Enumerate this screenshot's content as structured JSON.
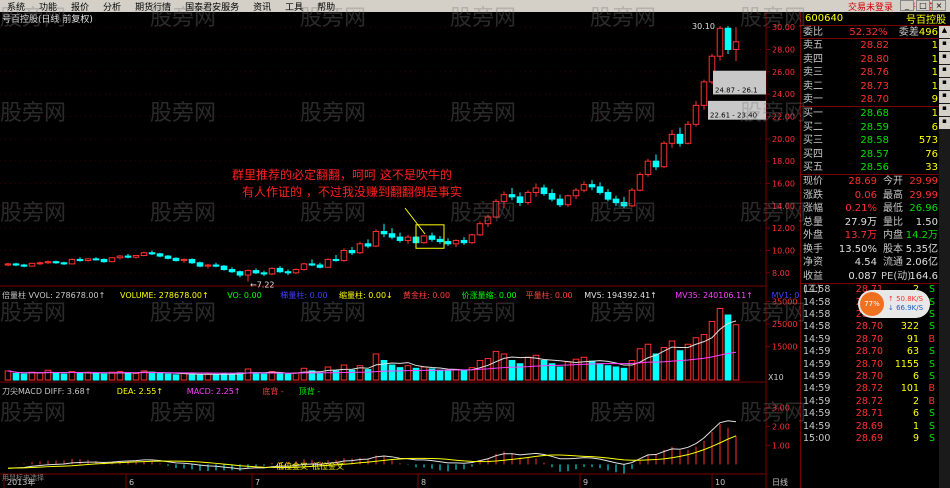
{
  "menu": {
    "items": [
      "系统",
      "功能",
      "报价",
      "分析",
      "期货行情",
      "国泰君安服务",
      "资讯",
      "工具",
      "帮助"
    ],
    "hot_items": [
      "交易未登录",
      "号百控股"
    ]
  },
  "stock": {
    "code": "600640",
    "name": "号百控股",
    "title": "号百控股(日线 前复权)"
  },
  "orderbook": {
    "weibi_label": "委比",
    "weibi": "52.32%",
    "weicha_label": "委差",
    "weicha": "496",
    "asks": [
      {
        "label": "卖五",
        "price": "28.82",
        "vol": "1"
      },
      {
        "label": "卖四",
        "price": "28.80",
        "vol": "1"
      },
      {
        "label": "卖三",
        "price": "28.76",
        "vol": "1"
      },
      {
        "label": "卖二",
        "price": "28.73",
        "vol": "1"
      },
      {
        "label": "卖一",
        "price": "28.70",
        "vol": "9"
      }
    ],
    "bids": [
      {
        "label": "买一",
        "price": "28.68",
        "vol": "1"
      },
      {
        "label": "买二",
        "price": "28.59",
        "vol": "6"
      },
      {
        "label": "买三",
        "price": "28.58",
        "vol": "573"
      },
      {
        "label": "买四",
        "price": "28.57",
        "vol": "76"
      },
      {
        "label": "买五",
        "price": "28.56",
        "vol": "33"
      }
    ]
  },
  "stats": [
    {
      "a": "现价",
      "b": "28.69",
      "c": "今开",
      "d": "29.99"
    },
    {
      "a": "涨跌",
      "b": "0.06",
      "c": "最高",
      "d": "29.99"
    },
    {
      "a": "涨幅",
      "b": "0.21%",
      "c": "最低",
      "d": "26.96"
    },
    {
      "a": "总量",
      "b": "27.9万",
      "c": "量比",
      "d": "1.50"
    },
    {
      "a": "外盘",
      "b": "13.7万",
      "c": "内盘",
      "d": "14.2万"
    },
    {
      "a": "换手",
      "b": "13.50%",
      "c": "股本",
      "d": "5.35亿"
    },
    {
      "a": "净资",
      "b": "4.54",
      "c": "流通",
      "d": "2.06亿"
    },
    {
      "a": "收益(二)",
      "b": "0.087",
      "c": "PE(动)",
      "d": "164.6"
    }
  ],
  "ticks": [
    {
      "t": "14:58",
      "p": "28.71",
      "v": "2",
      "s": "S"
    },
    {
      "t": "14:58",
      "p": "28.73",
      "v": "55",
      "s": "S"
    },
    {
      "t": "14:58",
      "p": "28.72",
      "v": "297",
      "s": "S"
    },
    {
      "t": "14:58",
      "p": "28.70",
      "v": "322",
      "s": "S"
    },
    {
      "t": "14:59",
      "p": "28.70",
      "v": "91",
      "s": "B"
    },
    {
      "t": "14:59",
      "p": "28.70",
      "v": "63",
      "s": "S"
    },
    {
      "t": "14:59",
      "p": "28.70",
      "v": "1155",
      "s": "S"
    },
    {
      "t": "14:59",
      "p": "28.70",
      "v": "6",
      "s": "S"
    },
    {
      "t": "14:59",
      "p": "28.72",
      "v": "101",
      "s": "B"
    },
    {
      "t": "14:59",
      "p": "28.72",
      "v": "2",
      "s": "B"
    },
    {
      "t": "14:59",
      "p": "28.71",
      "v": "6",
      "s": "S"
    },
    {
      "t": "14:59",
      "p": "28.69",
      "v": "1",
      "s": "S"
    },
    {
      "t": "15:00",
      "p": "28.69",
      "v": "9",
      "s": "S"
    }
  ],
  "net_widget": {
    "pct": "77%",
    "up": "↑ 50.8K/S",
    "down": "↓ 66.9K/S"
  },
  "price_axis": [
    "30.00",
    "28.00",
    "26.00",
    "24.00",
    "22.00",
    "20.00",
    "18.00",
    "16.00",
    "14.00",
    "12.00",
    "10.00",
    "8.00"
  ],
  "price_labels": {
    "high": "30.10",
    "low": "7.22",
    "box1": "24.87 - 26.1",
    "box2": "22.61 - 23.40"
  },
  "annotation": {
    "line1": "群里推荐的必定翻翻，呵呵  这不是吹牛的",
    "line2": "有人作证的    ，不过我没赚到翻翻倒是事实"
  },
  "vol_header": [
    {
      "text": "倍量柱 VVOL: 278678.00↑",
      "color": "#c8c8c8"
    },
    {
      "text": "VOLUME: 278678.00↑",
      "color": "#ffff00"
    },
    {
      "text": "VO: 0.00",
      "color": "#00ff00"
    },
    {
      "text": "梯量柱: 0.00",
      "color": "#4040ff"
    },
    {
      "text": "缩量柱: 0.00↓",
      "color": "#ffff00"
    },
    {
      "text": "黄金柱: 0.00",
      "color": "#ff4040"
    },
    {
      "text": "价涨量缩: 0.00",
      "color": "#00ff00"
    },
    {
      "text": "平量柱: 0.00",
      "color": "#ff4040"
    },
    {
      "text": "MV5: 194392.41↑",
      "color": "#e0e0e0"
    },
    {
      "text": "MV35: 240106.11↑",
      "color": "#ff40ff"
    },
    {
      "text": "MV1: 0↑",
      "color": "#4040ff"
    }
  ],
  "vol_axis": [
    "35000",
    "25000",
    "15000"
  ],
  "vol_unit": "X10",
  "macd_header": [
    {
      "text": "刀尖MACD DIFF: 3.68↑",
      "color": "#c8c8c8"
    },
    {
      "text": "DEA: 2.55↑",
      "color": "#ffff00"
    },
    {
      "text": "MACD: 2.25↑",
      "color": "#ff40ff"
    },
    {
      "text": "底背 -",
      "color": "#ff4040"
    },
    {
      "text": "顶背 -",
      "color": "#00ff00"
    }
  ],
  "macd_axis": [
    "3.00",
    "2.00",
    "1.00"
  ],
  "macd_labels": {
    "a": "低位金叉",
    "b": "低位金叉"
  },
  "date_axis": [
    "2013年",
    "6",
    "7",
    "8",
    "9",
    "10"
  ],
  "period": "日线",
  "bottom_left": "用鼠标来选择",
  "watermark": "股旁网",
  "colors": {
    "up": "#ff3030",
    "down": "#00ffff",
    "axis": "#7a0000",
    "grid": "#3a0000"
  },
  "candles": [
    [
      8.7,
      8.9,
      8.6,
      8.8
    ],
    [
      8.8,
      8.9,
      8.6,
      8.7
    ],
    [
      8.7,
      8.8,
      8.5,
      8.6
    ],
    [
      8.6,
      8.9,
      8.6,
      8.85
    ],
    [
      8.85,
      9.0,
      8.7,
      8.9
    ],
    [
      8.9,
      9.1,
      8.8,
      9.0
    ],
    [
      9.0,
      9.1,
      8.8,
      8.9
    ],
    [
      8.9,
      9.0,
      8.7,
      8.8
    ],
    [
      8.8,
      9.3,
      8.8,
      9.2
    ],
    [
      9.2,
      9.4,
      9.0,
      9.1
    ],
    [
      9.1,
      9.3,
      9.0,
      9.25
    ],
    [
      9.25,
      9.4,
      9.1,
      9.2
    ],
    [
      9.2,
      9.3,
      8.9,
      9.0
    ],
    [
      9.0,
      9.4,
      9.0,
      9.35
    ],
    [
      9.35,
      9.6,
      9.2,
      9.5
    ],
    [
      9.5,
      9.7,
      9.3,
      9.4
    ],
    [
      9.4,
      9.6,
      9.3,
      9.55
    ],
    [
      9.55,
      9.9,
      9.5,
      9.8
    ],
    [
      9.8,
      10.0,
      9.6,
      9.7
    ],
    [
      9.7,
      9.8,
      9.4,
      9.5
    ],
    [
      9.5,
      9.6,
      9.2,
      9.3
    ],
    [
      9.3,
      9.4,
      9.0,
      9.1
    ],
    [
      9.1,
      9.3,
      8.9,
      9.2
    ],
    [
      9.2,
      9.3,
      8.8,
      8.9
    ],
    [
      8.9,
      9.0,
      8.5,
      8.6
    ],
    [
      8.6,
      8.8,
      8.4,
      8.7
    ],
    [
      8.7,
      8.9,
      8.5,
      8.6
    ],
    [
      8.6,
      8.7,
      8.2,
      8.3
    ],
    [
      8.3,
      8.5,
      8.0,
      8.1
    ],
    [
      8.1,
      8.2,
      7.6,
      7.8
    ],
    [
      7.8,
      8.3,
      7.22,
      8.2
    ],
    [
      8.2,
      8.4,
      7.9,
      8.0
    ],
    [
      8.0,
      8.2,
      7.7,
      7.9
    ],
    [
      7.9,
      8.5,
      7.8,
      8.4
    ],
    [
      8.4,
      8.6,
      8.0,
      8.1
    ],
    [
      8.1,
      8.3,
      7.8,
      8.0
    ],
    [
      8.0,
      8.4,
      7.9,
      8.3
    ],
    [
      8.3,
      8.9,
      8.2,
      8.8
    ],
    [
      8.8,
      9.2,
      8.6,
      8.7
    ],
    [
      8.7,
      8.9,
      8.4,
      8.5
    ],
    [
      8.5,
      9.3,
      8.5,
      9.2
    ],
    [
      9.2,
      9.6,
      9.0,
      9.1
    ],
    [
      9.1,
      10.2,
      9.0,
      10.0
    ],
    [
      10.0,
      10.3,
      9.6,
      9.8
    ],
    [
      9.8,
      10.8,
      9.7,
      10.6
    ],
    [
      10.6,
      11.0,
      10.2,
      10.4
    ],
    [
      10.4,
      11.9,
      10.3,
      11.7
    ],
    [
      11.7,
      12.4,
      11.2,
      11.5
    ],
    [
      11.5,
      12.0,
      11.0,
      11.2
    ],
    [
      11.2,
      11.6,
      10.7,
      10.9
    ],
    [
      10.9,
      11.4,
      10.6,
      11.2
    ],
    [
      11.2,
      11.5,
      10.5,
      10.7
    ],
    [
      10.7,
      11.4,
      10.6,
      11.3
    ],
    [
      11.3,
      11.6,
      10.8,
      11.0
    ],
    [
      11.0,
      11.3,
      10.6,
      10.8
    ],
    [
      10.8,
      11.1,
      10.4,
      10.6
    ],
    [
      10.6,
      11.0,
      10.3,
      10.9
    ],
    [
      10.9,
      11.2,
      10.5,
      10.7
    ],
    [
      10.7,
      11.5,
      10.6,
      11.4
    ],
    [
      11.4,
      12.6,
      11.3,
      12.4
    ],
    [
      12.4,
      13.2,
      12.1,
      13.0
    ],
    [
      13.0,
      14.6,
      12.9,
      14.4
    ],
    [
      14.4,
      15.3,
      13.8,
      15.0
    ],
    [
      15.0,
      15.6,
      14.5,
      14.8
    ],
    [
      14.8,
      15.2,
      14.0,
      14.3
    ],
    [
      14.3,
      15.4,
      14.1,
      15.2
    ],
    [
      15.2,
      16.0,
      14.8,
      15.6
    ],
    [
      15.6,
      15.9,
      14.9,
      15.1
    ],
    [
      15.1,
      15.5,
      14.4,
      14.6
    ],
    [
      14.6,
      15.0,
      13.9,
      14.1
    ],
    [
      14.1,
      15.0,
      13.9,
      14.9
    ],
    [
      14.9,
      15.6,
      14.6,
      15.4
    ],
    [
      15.4,
      16.2,
      15.2,
      15.9
    ],
    [
      15.9,
      16.3,
      15.4,
      15.7
    ],
    [
      15.7,
      16.1,
      15.0,
      15.2
    ],
    [
      15.2,
      15.5,
      14.4,
      14.6
    ],
    [
      14.6,
      14.9,
      14.0,
      14.3
    ],
    [
      14.3,
      14.8,
      13.8,
      14.0
    ],
    [
      14.0,
      15.6,
      13.9,
      15.4
    ],
    [
      15.4,
      17.0,
      15.3,
      16.8
    ],
    [
      16.8,
      18.2,
      16.6,
      18.0
    ],
    [
      18.0,
      18.6,
      17.2,
      17.5
    ],
    [
      17.5,
      19.8,
      17.4,
      19.6
    ],
    [
      19.6,
      20.8,
      19.2,
      20.4
    ],
    [
      20.4,
      21.0,
      19.3,
      19.6
    ],
    [
      19.6,
      21.6,
      19.5,
      21.3
    ],
    [
      21.3,
      23.4,
      21.1,
      23.0
    ],
    [
      23.0,
      25.3,
      22.6,
      25.1
    ],
    [
      25.1,
      27.6,
      24.9,
      27.4
    ],
    [
      27.4,
      30.1,
      27.0,
      29.9
    ],
    [
      29.9,
      30.1,
      27.6,
      28.0
    ],
    [
      28.0,
      29.99,
      26.96,
      28.69
    ]
  ],
  "volumes": [
    28,
    20,
    18,
    24,
    22,
    30,
    20,
    18,
    26,
    22,
    24,
    20,
    18,
    24,
    26,
    22,
    20,
    28,
    24,
    20,
    18,
    16,
    20,
    18,
    16,
    18,
    16,
    20,
    18,
    22,
    34,
    20,
    18,
    26,
    20,
    18,
    22,
    36,
    28,
    22,
    40,
    28,
    46,
    30,
    44,
    32,
    80,
    60,
    46,
    38,
    44,
    36,
    40,
    34,
    30,
    28,
    32,
    30,
    38,
    60,
    66,
    88,
    80,
    60,
    50,
    70,
    76,
    60,
    50,
    40,
    56,
    64,
    70,
    58,
    50,
    44,
    40,
    36,
    60,
    96,
    110,
    80,
    100,
    120,
    90,
    110,
    130,
    140,
    180,
    220,
    200,
    170
  ],
  "macd": [
    -0.2,
    -0.18,
    -0.16,
    -0.1,
    -0.06,
    -0.02,
    0.0,
    0.02,
    0.08,
    0.1,
    0.12,
    0.12,
    0.1,
    0.12,
    0.16,
    0.18,
    0.2,
    0.24,
    0.24,
    0.2,
    0.14,
    0.08,
    0.06,
    0.02,
    -0.04,
    -0.08,
    -0.1,
    -0.14,
    -0.18,
    -0.24,
    -0.2,
    -0.18,
    -0.18,
    -0.12,
    -0.1,
    -0.1,
    -0.06,
    0.0,
    0.02,
    0.0,
    0.06,
    0.1,
    0.18,
    0.2,
    0.26,
    0.28,
    0.4,
    0.44,
    0.4,
    0.32,
    0.3,
    0.24,
    0.24,
    0.2,
    0.14,
    0.08,
    0.08,
    0.06,
    0.1,
    0.2,
    0.3,
    0.46,
    0.56,
    0.56,
    0.5,
    0.54,
    0.58,
    0.52,
    0.42,
    0.3,
    0.3,
    0.32,
    0.36,
    0.34,
    0.28,
    0.18,
    0.08,
    0.0,
    0.1,
    0.3,
    0.5,
    0.52,
    0.68,
    0.82,
    0.8,
    0.9,
    1.1,
    1.4,
    1.8,
    2.2,
    2.3,
    2.25
  ]
}
